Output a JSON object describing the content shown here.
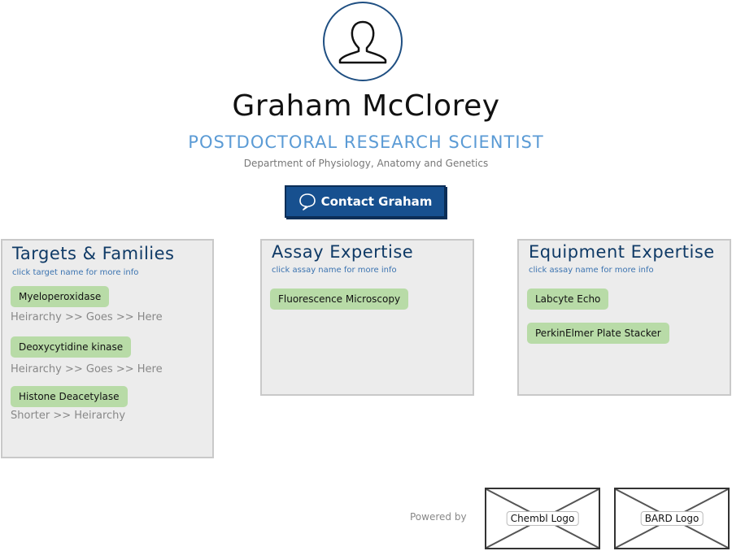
{
  "profile": {
    "avatar_icon": "user-icon",
    "name": "Graham McClorey",
    "title": "POSTDOCTORAL RESEARCH SCIENTIST",
    "department": "Department of Physiology, Anatomy and Genetics",
    "contact_label": "Contact Graham",
    "contact_icon": "speech-bubble-icon"
  },
  "targets": {
    "title": "Targets & Families",
    "hint": "click target name for more info",
    "items": [
      {
        "name": "Myeloperoxidase",
        "hierarchy": "Heirarchy >> Goes >> Here"
      },
      {
        "name": "Deoxycytidine kinase",
        "hierarchy": "Heirarchy >> Goes >> Here"
      },
      {
        "name": "Histone Deacetylase",
        "hierarchy": "Shorter >> Heirarchy"
      }
    ]
  },
  "assay": {
    "title": "Assay Expertise",
    "hint": "click assay name for more info",
    "items": [
      "Fluorescence Microscopy"
    ]
  },
  "equipment": {
    "title": "Equipment Expertise",
    "hint": "click assay name for more info",
    "items": [
      "Labcyte Echo",
      "PerkinElmer Plate Stacker"
    ]
  },
  "footer": {
    "powered_by": "Powered by",
    "logos": [
      "Chembl Logo",
      "BARD Logo"
    ]
  },
  "colors": {
    "accent_blue": "#17508f",
    "title_blue": "#5b9bd5",
    "chip_green": "#b8dba7",
    "panel_bg": "#ececec"
  }
}
